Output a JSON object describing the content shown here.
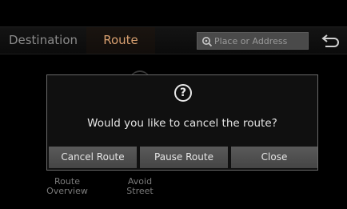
{
  "nav": {
    "tabs": [
      {
        "label": "Destination"
      },
      {
        "label": "Route"
      }
    ],
    "active_tab": "Route",
    "search_placeholder": "Place or Address",
    "back_icon": "back-arrow-icon"
  },
  "background_menu": {
    "items": [
      {
        "label": "Route\nOverview"
      },
      {
        "label": "Avoid\nStreet"
      }
    ]
  },
  "dialog": {
    "icon": "question-icon",
    "icon_glyph": "?",
    "message": "Would you like to cancel the route?",
    "buttons": {
      "cancel_route": "Cancel Route",
      "pause_route": "Pause Route",
      "close": "Close"
    }
  },
  "colors": {
    "active_tab": "#d8a070",
    "dialog_border": "#6a6a6a",
    "button_bg": "#505050"
  }
}
